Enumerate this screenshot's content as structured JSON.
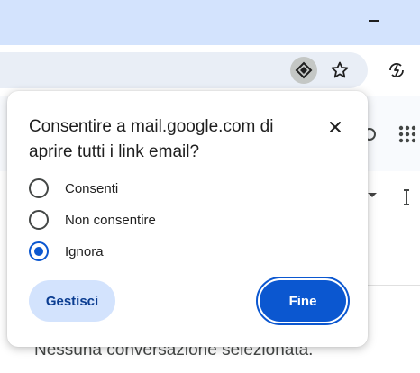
{
  "browser": {
    "icons": {
      "minimize": "minimize-icon",
      "protocol_handler": "protocol-handler-icon",
      "bookmark": "star-icon",
      "extension": "extension-icon"
    }
  },
  "page": {
    "empty_message": "Nessuna conversazione selezionata."
  },
  "dialog": {
    "title": "Consentire a mail.google.com di aprire tutti i link email?",
    "options": [
      {
        "label": "Consenti",
        "selected": false
      },
      {
        "label": "Non consentire",
        "selected": false
      },
      {
        "label": "Ignora",
        "selected": true
      }
    ],
    "manage_label": "Gestisci",
    "done_label": "Fine"
  },
  "colors": {
    "accent": "#0b57d0",
    "titlebar": "#d3e3fd",
    "omnibox": "#e9eef6"
  }
}
